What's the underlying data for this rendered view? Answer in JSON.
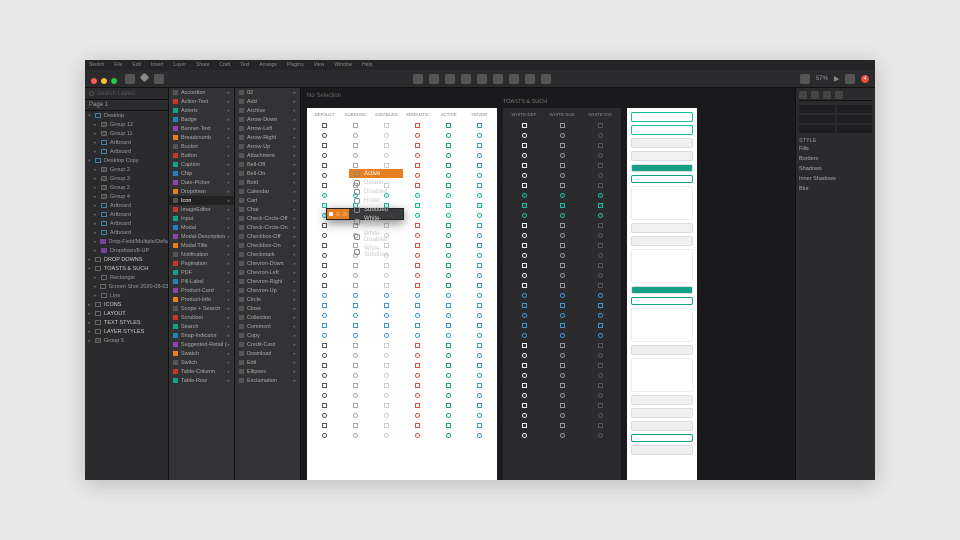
{
  "menubar": [
    "Sketch",
    "File",
    "Edit",
    "Insert",
    "Layer",
    "Share",
    "Craft",
    "Text",
    "Arrange",
    "Plugins",
    "View",
    "Window",
    "Help"
  ],
  "toolbar": {
    "zoom": "57%",
    "notif_count": "4"
  },
  "layers_panel": {
    "search_placeholder": "Search Layers",
    "page_label": "Page 1",
    "items": [
      {
        "label": "Desktop",
        "type": "folder",
        "indent": 0,
        "expanded": true
      },
      {
        "label": "Group 12",
        "type": "group",
        "indent": 1
      },
      {
        "label": "Group 11",
        "type": "group",
        "indent": 1
      },
      {
        "label": "Artboard",
        "type": "folder",
        "indent": 1
      },
      {
        "label": "Artboard",
        "type": "folder",
        "indent": 1
      },
      {
        "label": "Desktop Copy",
        "type": "folder",
        "indent": 0,
        "expanded": true
      },
      {
        "label": "Group 2",
        "type": "group",
        "indent": 1
      },
      {
        "label": "Group 3",
        "type": "group",
        "indent": 1
      },
      {
        "label": "Group 2",
        "type": "group",
        "indent": 1
      },
      {
        "label": "Group 4",
        "type": "group",
        "indent": 1
      },
      {
        "label": "Artboard",
        "type": "folder",
        "indent": 1
      },
      {
        "label": "Artboard",
        "type": "folder",
        "indent": 1
      },
      {
        "label": "Artboard",
        "type": "folder",
        "indent": 1
      },
      {
        "label": "Artboard",
        "type": "folder",
        "indent": 1
      },
      {
        "label": "Drop-Field/Multiple/Defau",
        "type": "purple",
        "indent": 1
      },
      {
        "label": "Dropdown/8-UP",
        "type": "purple",
        "indent": 1
      },
      {
        "label": "DROP DOWNS",
        "type": "header",
        "indent": 0
      },
      {
        "label": "TOASTS & SUCH",
        "type": "header",
        "indent": 0,
        "expanded": true
      },
      {
        "label": "Rectangle",
        "type": "shape",
        "indent": 1
      },
      {
        "label": "Screen Shot 2020-08-03 ...",
        "type": "image",
        "indent": 1
      },
      {
        "label": "Line",
        "type": "shape",
        "indent": 1
      },
      {
        "label": "ICONS",
        "type": "header",
        "indent": 0
      },
      {
        "label": "LAYOUT",
        "type": "header",
        "indent": 0
      },
      {
        "label": "TEXT STYLES",
        "type": "header",
        "indent": 0
      },
      {
        "label": "LAYER STYLES",
        "type": "header",
        "indent": 0
      },
      {
        "label": "Group 5",
        "type": "group",
        "indent": 0
      }
    ]
  },
  "flyout1": {
    "items": [
      "Accordion",
      "Action-Text",
      "Asterix",
      "Badge",
      "Banner-Text",
      "Breadcrumb",
      "Bucket",
      "Button",
      "Caption",
      "Chip",
      "Date-Picker",
      "Dropdown",
      "Icon",
      "ImageEditor",
      "Input",
      "Modal",
      "Modal-Description",
      "Modal Title",
      "Notification",
      "Pagination",
      "PDF",
      "Pill-Label",
      "Product-Card",
      "Product-Info",
      "Scope + Search",
      "Scrubber",
      "Search",
      "Snap-Indicator",
      "Suggested-Retail (PDF)",
      "Swatch",
      "Switch",
      "Table-Column",
      "Table-Row"
    ],
    "selected": "Icon"
  },
  "flyout2": {
    "items": [
      "02",
      "Add",
      "Archive",
      "Arrow-Down",
      "Arrow-Left",
      "Arrow-Right",
      "Arrow-Up",
      "Attachment",
      "Bell-Off",
      "Bell-On",
      "Bold",
      "Calendar",
      "Cart",
      "Chat",
      "Check-Circle-Off",
      "Check-Circle-On",
      "Checkbox-Off",
      "Checkbox-On",
      "Checkmark",
      "Chevron-Down",
      "Chevron-Left",
      "Chevron-Right",
      "Chevron-Up",
      "Circle",
      "Close",
      "Collection",
      "Comment",
      "Copy",
      "Credit-Card",
      "Download",
      "Edit",
      "Ellipses",
      "Exclamation"
    ]
  },
  "popup": {
    "size_options": [
      "S",
      "M",
      "L"
    ],
    "selected_size": 0,
    "states": [
      "Active",
      "Default",
      "Disabled",
      "Hover",
      "Subdued",
      "White-Default",
      "White-Disabled",
      "White-Subdued"
    ],
    "selected_state": "Active"
  },
  "canvas": {
    "header": "No Selection",
    "artboard2_title": "TOASTS & SUCH",
    "grid_headers_light": [
      "DEFAULT",
      "SUBDUED",
      "DISABLED",
      "SEMANTIC",
      "ACTIVE",
      "HOVER"
    ],
    "grid_headers_dark": [
      "WHITE-DEF",
      "WHITE-SUB",
      "WHITE-DIS"
    ],
    "row_count": 32
  },
  "inspector": {
    "sections": {
      "style": "STYLE",
      "fills": "Fills",
      "borders": "Borders",
      "shadows": "Shadows",
      "inner_shadows": "Inner Shadows",
      "blur": "Blur"
    }
  }
}
